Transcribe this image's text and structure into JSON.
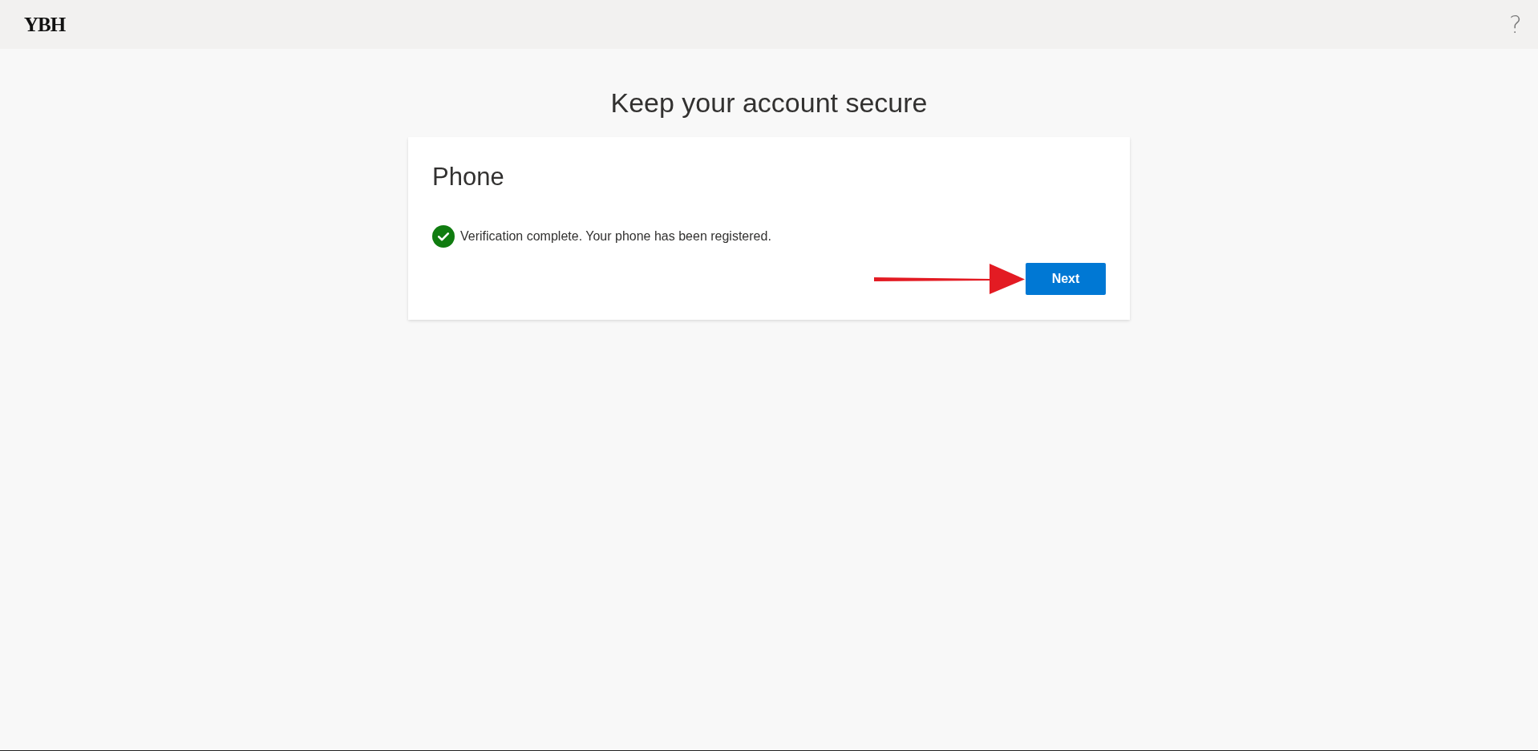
{
  "header": {
    "logo": "YBH",
    "help": "?"
  },
  "title": "Keep your account secure",
  "card": {
    "heading": "Phone",
    "message": "Verification complete. Your phone has been registered.",
    "next_button": "Next"
  }
}
